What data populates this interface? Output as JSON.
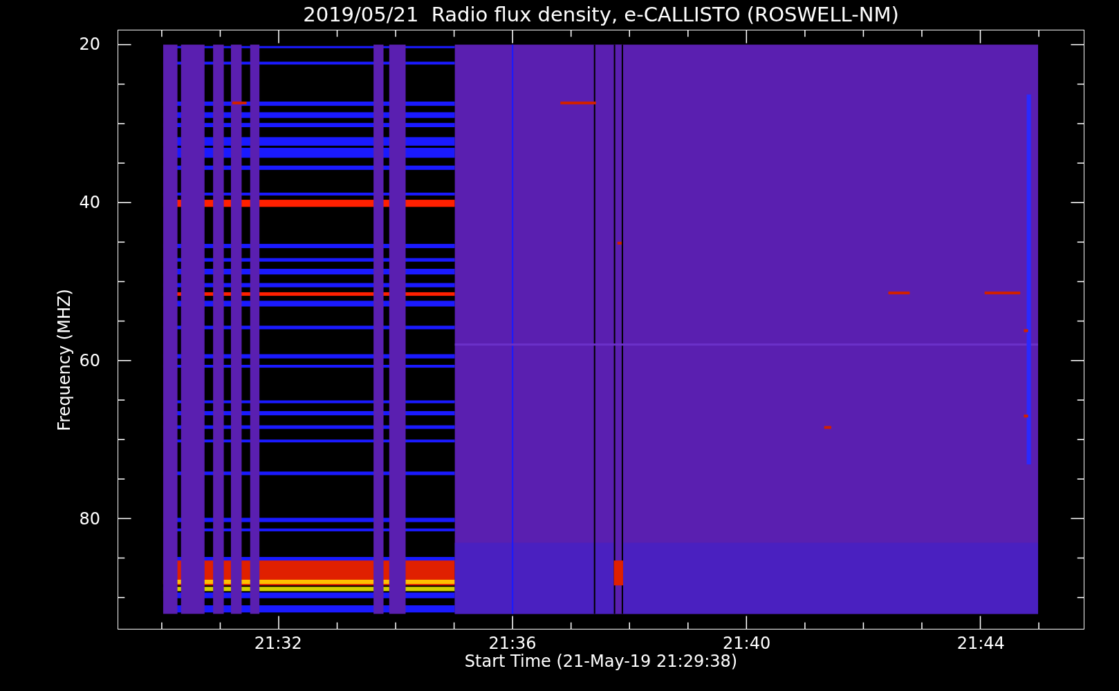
{
  "title": "2019/05/21  Radio flux density, e-CALLISTO (ROSWELL-NM)",
  "y_axis": {
    "label": "Frequency (MHZ)",
    "ticks": [
      "20",
      "40",
      "60",
      "80"
    ]
  },
  "x_axis": {
    "label": "Start Time (21-May-19 21:29:38)",
    "ticks": [
      "21:32",
      "21:36",
      "21:40",
      "21:44"
    ]
  }
}
